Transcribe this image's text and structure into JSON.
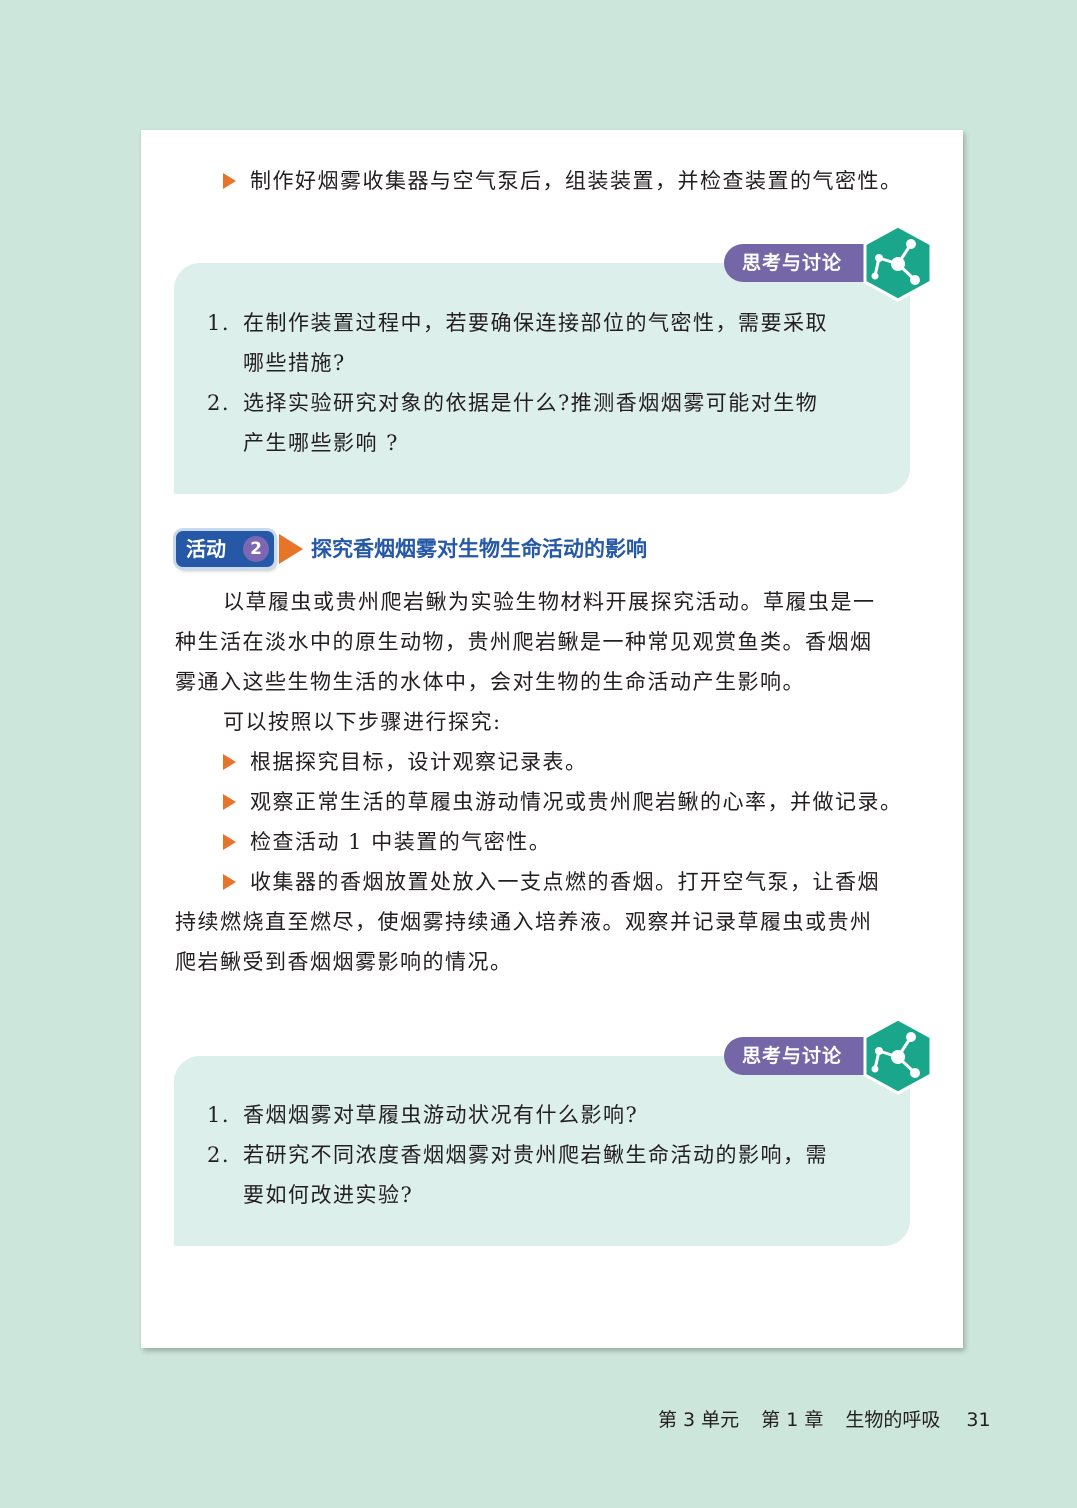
{
  "intro_bullet": "制作好烟雾收集器与空气泵后，组装装置，并检查装置的气密性。",
  "think1": {
    "tag": "思考与讨论",
    "q1_num": "1.",
    "q1_line1": "在制作装置过程中，若要确保连接部位的气密性，需要采取",
    "q1_line2": "哪些措施?",
    "q2_num": "2.",
    "q2_line1": "选择实验研究对象的依据是什么?推测香烟烟雾可能对生物",
    "q2_line2": "产生哪些影响 ?"
  },
  "activity": {
    "label": "活动",
    "number": "2",
    "title": "探究香烟烟雾对生物生命活动的影响"
  },
  "body": {
    "p1_line1": "以草履虫或贵州爬岩鳅为实验生物材料开展探究活动。草履虫是一",
    "p1_line2": "种生活在淡水中的原生动物，贵州爬岩鳅是一种常见观赏鱼类。香烟烟",
    "p1_line3": "雾通入这些生物生活的水体中，会对生物的生命活动产生影响。",
    "p2": "可以按照以下步骤进行探究:",
    "step1": "根据探究目标，设计观察记录表。",
    "step2": "观察正常生活的草履虫游动情况或贵州爬岩鳅的心率，并做记录。",
    "step3": "检查活动 1 中装置的气密性。",
    "step4_line1": "收集器的香烟放置处放入一支点燃的香烟。打开空气泵，让香烟",
    "step4_line2": "持续燃烧直至燃尽，使烟雾持续通入培养液。观察并记录草履虫或贵州",
    "step4_line3": "爬岩鳅受到香烟烟雾影响的情况。"
  },
  "think2": {
    "tag": "思考与讨论",
    "q1_num": "1.",
    "q1_line1": "香烟烟雾对草履虫游动状况有什么影响?",
    "q2_num": "2.",
    "q2_line1": "若研究不同浓度香烟烟雾对贵州爬岩鳅生命活动的影响，需",
    "q2_line2": "要如何改进实验?"
  },
  "footer": {
    "unit": "第 3 单元",
    "chapter": "第 1 章",
    "chapter_title": "生物的呼吸",
    "page_number": "31"
  },
  "colors": {
    "background": "#cde6dc",
    "bullet": "#e8742a",
    "think_box": "#ddefea",
    "think_tag": "#7566a8",
    "think_icon": "#1aa68a",
    "activity_blue": "#2558a6"
  },
  "icons": {
    "bullet": "orange-triangle-icon",
    "think": "molecule-network-icon"
  }
}
